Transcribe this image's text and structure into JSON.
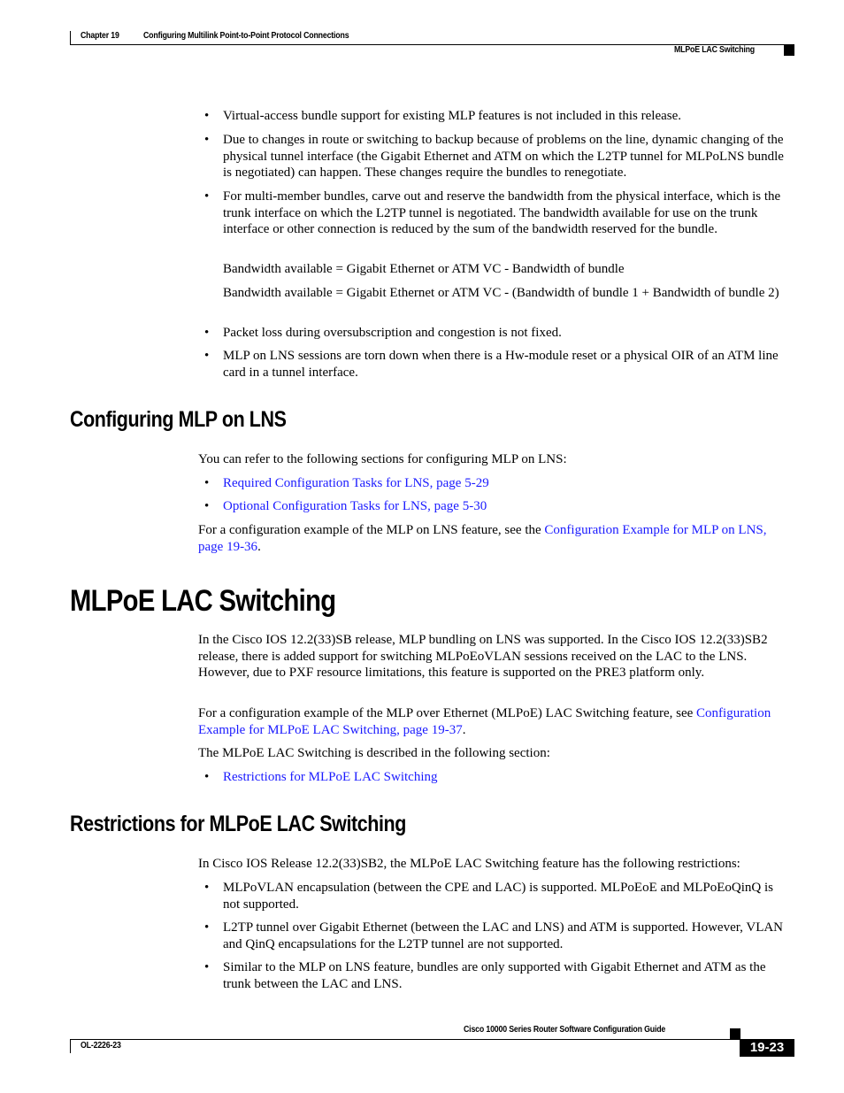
{
  "header": {
    "chapter": "Chapter 19",
    "chapter_title": "Configuring Multilink Point-to-Point Protocol Connections",
    "section": "MLPoE LAC Switching"
  },
  "top_bullets": [
    "Virtual-access bundle support for existing MLP features is not included in this release.",
    "Due to changes in route or switching to backup because of problems on the line, dynamic changing of the physical tunnel interface (the Gigabit Ethernet and ATM on which the L2TP tunnel for MLPoLNS bundle is negotiated) can happen. These changes require the bundles to renegotiate.",
    "For multi-member bundles, carve out and reserve the bandwidth from the physical interface, which is the trunk interface on which the L2TP tunnel is negotiated. The bandwidth available for use on the trunk interface or other connection is reduced by the sum of the bandwidth reserved for the bundle.",
    "Packet loss during oversubscription and congestion is not fixed.",
    "MLP on LNS sessions are torn down when there is a Hw-module reset or a physical OIR of an ATM line card in a tunnel interface."
  ],
  "formulas": [
    "Bandwidth available = Gigabit Ethernet or ATM VC - Bandwidth of bundle",
    "Bandwidth available = Gigabit Ethernet or ATM VC - (Bandwidth of bundle 1 + Bandwidth of bundle 2)"
  ],
  "section_mlp_lns": {
    "title": "Configuring MLP on LNS",
    "intro": "You can refer to the following sections for configuring MLP on LNS:",
    "links": [
      "Required Configuration Tasks for LNS, page 5-29",
      "Optional Configuration Tasks for LNS, page 5-30"
    ],
    "example_prefix": "For a configuration example of the MLP on LNS feature, see the ",
    "example_link": "Configuration Example for MLP on LNS, page 19-36",
    "example_suffix": "."
  },
  "section_mlpoe": {
    "title": "MLPoE LAC Switching",
    "para1": "In the Cisco IOS 12.2(33)SB release, MLP bundling on LNS was supported. In the Cisco IOS 12.2(33)SB2 release, there is added support for switching MLPoEoVLAN sessions received on the LAC to the LNS. However, due to PXF resource limitations, this feature is supported on the PRE3 platform only.",
    "example_prefix": "For a configuration example of the MLP over Ethernet (MLPoE) LAC Switching feature, see ",
    "example_link": "Configuration Example for MLPoE LAC Switching, page 19-37",
    "example_suffix": ".",
    "para3": "The MLPoE LAC Switching is described in the following section:",
    "links": [
      "Restrictions for MLPoE LAC Switching"
    ]
  },
  "section_restrictions": {
    "title": "Restrictions for MLPoE LAC Switching",
    "intro": "In Cisco IOS Release 12.2(33)SB2, the MLPoE LAC Switching feature has the following restrictions:",
    "bullets": [
      "MLPoVLAN encapsulation (between the CPE and LAC) is supported. MLPoEoE and MLPoEoQinQ is not supported.",
      "L2TP tunnel over Gigabit Ethernet (between the LAC and LNS) and ATM is supported. However, VLAN and QinQ encapsulations for the L2TP tunnel are not supported.",
      "Similar to the MLP on LNS feature, bundles are only supported with Gigabit Ethernet and ATM as the trunk between the LAC and LNS."
    ]
  },
  "footer": {
    "guide_title": "Cisco 10000 Series Router Software Configuration Guide",
    "doc_id": "OL-2226-23",
    "page_number": "19-23"
  },
  "bullet_glyph": "•"
}
